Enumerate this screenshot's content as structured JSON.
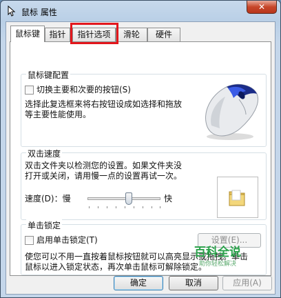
{
  "window": {
    "title": "鼠标 属性",
    "close_label": "✕"
  },
  "tabs": [
    {
      "label": "鼠标键",
      "active": true
    },
    {
      "label": "指针",
      "active": false
    },
    {
      "label": "指针选项",
      "active": false
    },
    {
      "label": "滑轮",
      "active": false
    },
    {
      "label": "硬件",
      "active": false
    }
  ],
  "buttons_config": {
    "legend": "鼠标键配置",
    "switch_label": "切换主要和次要的按钮(S)",
    "switch_checked": false,
    "desc_line1": "选择此复选框来将右按钮设成如选择和拖放",
    "desc_line2": "等主要性能使用。"
  },
  "double_click": {
    "legend": "双击速度",
    "desc_line1": "双击文件夹以检测您的设置。如果文件夹没",
    "desc_line2": "打开或关闭，请用慢一点的设置再试一次。",
    "speed_label": "速度(D)：慢",
    "fast_label": "快",
    "speed_value": 0.5
  },
  "click_lock": {
    "legend": "单击锁定",
    "enable_label": "启用单击锁定(T)",
    "enable_checked": false,
    "settings_label": "设置(E)...",
    "desc_line1": "使您可以不用一直按着鼠标按钮就可以高亮显示或拖拽。单击",
    "desc_line2": "鼠标以进入锁定状态，再次单击鼠标可解除锁定。"
  },
  "footer": {
    "ok_label": "确定",
    "cancel_label": "取消",
    "apply_label": "应用(A)"
  },
  "watermark": {
    "main": "百科全说",
    "sub": "助你轻松解决"
  }
}
